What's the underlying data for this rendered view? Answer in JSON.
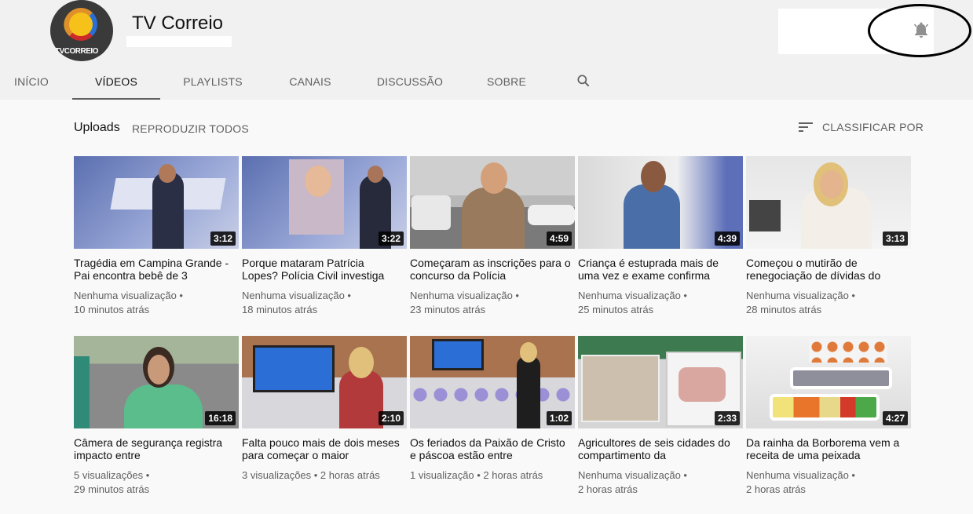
{
  "channel": {
    "name": "TV Correio",
    "avatar_text": "TVCORREIO"
  },
  "tabs": [
    {
      "label": "INÍCIO",
      "active": false
    },
    {
      "label": "VÍDEOS",
      "active": true
    },
    {
      "label": "PLAYLISTS",
      "active": false
    },
    {
      "label": "CANAIS",
      "active": false
    },
    {
      "label": "DISCUSSÃO",
      "active": false
    },
    {
      "label": "SOBRE",
      "active": false
    }
  ],
  "section": {
    "title": "Uploads",
    "play_all": "REPRODUZIR TODOS",
    "sort_label": "CLASSIFICAR POR"
  },
  "icons": {
    "bell": "notification-bell-icon",
    "search": "search-icon",
    "sort": "sort-icon"
  },
  "videos": [
    {
      "title": "Tragédia em Campina Grande - Pai encontra bebê de 3",
      "views": "Nenhuma visualização •",
      "time": "10 minutos atrás",
      "duration": "3:12"
    },
    {
      "title": "Porque mataram Patrícia Lopes? Polícia Civil investiga",
      "views": "Nenhuma visualização •",
      "time": "18 minutos atrás",
      "duration": "3:22"
    },
    {
      "title": "Começaram as inscrições para o concurso da Polícia",
      "views": "Nenhuma visualização •",
      "time": "23 minutos atrás",
      "duration": "4:59"
    },
    {
      "title": "Criança é estuprada mais de uma vez e exame confirma",
      "views": "Nenhuma visualização •",
      "time": "25 minutos atrás",
      "duration": "4:39"
    },
    {
      "title": "Começou o mutirão de renegociação de dívidas do",
      "views": "Nenhuma visualização •",
      "time": "28 minutos atrás",
      "duration": "3:13"
    },
    {
      "title": "Câmera de segurança registra impacto entre",
      "views": "5 visualizações •",
      "time": "29 minutos atrás",
      "duration": "16:18"
    },
    {
      "title": "Falta pouco mais de dois meses para começar o maior",
      "views": "3 visualizações • 2 horas atrás",
      "time": "",
      "duration": "2:10"
    },
    {
      "title": "Os feriados da Paixão de Cristo e páscoa estão entre",
      "views": "1 visualização • 2 horas atrás",
      "time": "",
      "duration": "1:02"
    },
    {
      "title": "Agricultores de seis cidades do compartimento da",
      "views": "Nenhuma visualização •",
      "time": "2 horas atrás",
      "duration": "2:33"
    },
    {
      "title": "Da rainha da Borborema vem a receita de uma peixada",
      "views": "Nenhuma visualização •",
      "time": "2 horas atrás",
      "duration": "4:27"
    }
  ]
}
